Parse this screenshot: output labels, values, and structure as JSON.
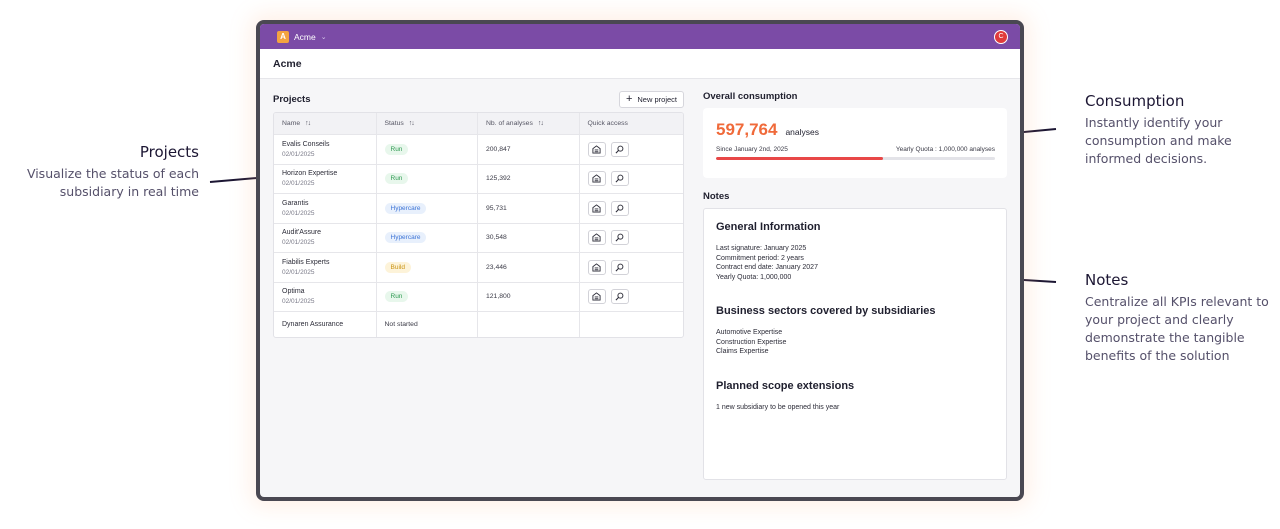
{
  "annotations": {
    "projects": {
      "title": "Projects",
      "desc": "Visualize the status of each subsidiary in real time"
    },
    "consumption": {
      "title": "Consumption",
      "desc": "Instantly identify your consumption and make informed decisions."
    },
    "notes": {
      "title": "Notes",
      "desc": "Centralize all KPIs relevant to your project and clearly demonstrate the tangible benefits of the solution"
    }
  },
  "topbar": {
    "org_initial": "A",
    "org_name": "Acme",
    "user_initial": "C"
  },
  "page": {
    "title": "Acme"
  },
  "projects": {
    "title": "Projects",
    "new_button": "New project",
    "columns": [
      "Name",
      "Status",
      "Nb. of analyses",
      "Quick access"
    ],
    "rows": [
      {
        "name": "Evalis Conseils",
        "date": "02/01/2025",
        "status": "Run",
        "analyses": "200,847"
      },
      {
        "name": "Horizon Expertise",
        "date": "02/01/2025",
        "status": "Run",
        "analyses": "125,392"
      },
      {
        "name": "Garantis",
        "date": "02/01/2025",
        "status": "Hypercare",
        "analyses": "95,731"
      },
      {
        "name": "Audit'Assure",
        "date": "02/01/2025",
        "status": "Hypercare",
        "analyses": "30,548"
      },
      {
        "name": "Fiabilis Experts",
        "date": "02/01/2025",
        "status": "Build",
        "analyses": "23,446"
      },
      {
        "name": "Optima",
        "date": "02/01/2025",
        "status": "Run",
        "analyses": "121,800"
      },
      {
        "name": "Dynaren Assurance",
        "date": "",
        "status": "Not started",
        "analyses": ""
      }
    ]
  },
  "consumption": {
    "title": "Overall consumption",
    "value": "597,764",
    "unit": "analyses",
    "since": "Since January 2nd, 2025",
    "quota": "Yearly Quota : 1,000,000 analyses",
    "progress_percent": 59.8
  },
  "notes": {
    "title": "Notes",
    "sections": [
      {
        "heading": "General Information",
        "lines": [
          "Last signature: January 2025",
          "Commitment period: 2 years",
          "Contract end date: January 2027",
          "Yearly Quota: 1,000,000"
        ]
      },
      {
        "heading": "Business sectors covered by subsidiaries",
        "lines": [
          "Automotive Expertise",
          "Construction Expertise",
          "Claims Expertise"
        ]
      },
      {
        "heading": "Planned scope extensions",
        "lines": [
          "1 new subsidiary to be opened this year"
        ]
      }
    ]
  },
  "colors": {
    "topbar": "#7b4ba6",
    "accent": "#f06a3a",
    "progress": "#e84747"
  }
}
